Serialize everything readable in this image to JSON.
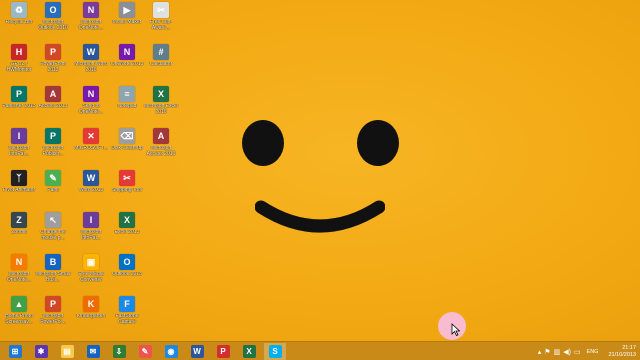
{
  "desktop": {
    "icons": [
      {
        "label": "Recycle Bin",
        "icon": "recycle-bin-icon",
        "color": "#9bb8c9",
        "glyph": "♻"
      },
      {
        "label": "Microsoft Outlook 2010",
        "icon": "outlook-icon",
        "color": "#2a6ebb",
        "glyph": "O"
      },
      {
        "label": "Microsoft OneNote...",
        "icon": "onenote-icon",
        "color": "#7b3b9a",
        "glyph": "N"
      },
      {
        "label": "Movie Maker",
        "icon": "movie-maker-icon",
        "color": "#8a8f9a",
        "glyph": "▶"
      },
      {
        "label": "Free Clip-Aware...",
        "icon": "clip-icon",
        "color": "#e0e0e0",
        "glyph": "✂"
      },
      {
        "label": "GPUZ / HWMonitor",
        "icon": "hwmonitor-icon",
        "color": "#c62828",
        "glyph": "H"
      },
      {
        "label": "PowerPoint 2013",
        "icon": "powerpoint-icon",
        "color": "#d24726",
        "glyph": "P"
      },
      {
        "label": "Microsoft Word 2010",
        "icon": "word-icon",
        "color": "#2b579a",
        "glyph": "W"
      },
      {
        "label": "OneNote 2013",
        "icon": "onenote-icon",
        "color": "#7719aa",
        "glyph": "N"
      },
      {
        "label": "Calculator",
        "icon": "calculator-icon",
        "color": "#607d8b",
        "glyph": "#"
      },
      {
        "label": "Publisher 2013",
        "icon": "publisher-icon",
        "color": "#077568",
        "glyph": "P"
      },
      {
        "label": "Access 2013",
        "icon": "access-icon",
        "color": "#a4373a",
        "glyph": "A"
      },
      {
        "label": "Send to OneNote...",
        "icon": "send-onenote-icon",
        "color": "#7719aa",
        "glyph": "N"
      },
      {
        "label": "Notepad",
        "icon": "notepad-icon",
        "color": "#90a4ae",
        "glyph": "≡"
      },
      {
        "label": "Microsoft Excel 2010",
        "icon": "excel-icon",
        "color": "#217346",
        "glyph": "X"
      },
      {
        "label": "Microsoft InfoPat...",
        "icon": "infopath-icon",
        "color": "#6a3d9a",
        "glyph": "I"
      },
      {
        "label": "Microsoft Publish...",
        "icon": "publisher-icon",
        "color": "#077568",
        "glyph": "P"
      },
      {
        "label": "MICROSOFT...",
        "icon": "media-icon",
        "color": "#e53935",
        "glyph": "✕"
      },
      {
        "label": "Disk Clean-up",
        "icon": "disk-cleanup-icon",
        "color": "#9e9e9e",
        "glyph": "⌫"
      },
      {
        "label": "Microsoft Access 2010",
        "icon": "access-icon",
        "color": "#a4373a",
        "glyph": "A"
      },
      {
        "label": "Pivot Animator",
        "icon": "pivot-icon",
        "color": "#212121",
        "glyph": "ᛉ"
      },
      {
        "label": "Paint",
        "icon": "paint-icon",
        "color": "#4caf50",
        "glyph": "✎"
      },
      {
        "label": "Word 2013",
        "icon": "word-icon",
        "color": "#2b579a",
        "glyph": "W"
      },
      {
        "label": "Snipping Tool",
        "icon": "snipping-tool-icon",
        "color": "#e53935",
        "glyph": "✂"
      },
      {
        "label": "Zoomit",
        "icon": "zoomit-icon",
        "color": "#37474f",
        "glyph": "Z"
      },
      {
        "label": "Change the mouse p...",
        "icon": "mouse-icon",
        "color": "#9e9e9e",
        "glyph": "↖"
      },
      {
        "label": "Microsoft InfoPat...",
        "icon": "infopath-icon",
        "color": "#6a3d9a",
        "glyph": "I"
      },
      {
        "label": "Excel 2013",
        "icon": "excel-icon",
        "color": "#217346",
        "glyph": "X"
      },
      {
        "label": "Microsoft OneNote...",
        "icon": "onenote-icon",
        "color": "#f57c00",
        "glyph": "N"
      },
      {
        "label": "Microsoft Small Busi...",
        "icon": "small-business-icon",
        "color": "#1565c0",
        "glyph": "B"
      },
      {
        "label": "Free Media Converter",
        "icon": "media-converter-icon",
        "color": "#ffb300",
        "glyph": "▣"
      },
      {
        "label": "Outlook 2013",
        "icon": "outlook-icon",
        "color": "#0072c6",
        "glyph": "O"
      },
      {
        "label": "Home Photo Screensav...",
        "icon": "photo-icon",
        "color": "#43a047",
        "glyph": "▲"
      },
      {
        "label": "Microsoft PowerPoi...",
        "icon": "powerpoint-icon",
        "color": "#d24726",
        "glyph": "P"
      },
      {
        "label": "Kindergarten",
        "icon": "kindergarten-icon",
        "color": "#ef6c00",
        "glyph": "K"
      },
      {
        "label": "FastStone Capture",
        "icon": "faststone-icon",
        "color": "#1e88e5",
        "glyph": "F"
      }
    ]
  },
  "taskbar": {
    "buttons": [
      {
        "name": "start-button",
        "icon": "windows-logo-icon",
        "color": "#1f78d1",
        "glyph": "⊞"
      },
      {
        "name": "taskbar-settings",
        "icon": "settings-icon",
        "color": "#5e35b1",
        "glyph": "✱"
      },
      {
        "name": "taskbar-explorer",
        "icon": "file-explorer-icon",
        "color": "#f9c846",
        "glyph": "▤"
      },
      {
        "name": "taskbar-outlook",
        "icon": "mail-icon",
        "color": "#1565c0",
        "glyph": "✉"
      },
      {
        "name": "taskbar-store",
        "icon": "download-icon",
        "color": "#2e7d32",
        "glyph": "⇩"
      },
      {
        "name": "taskbar-paint",
        "icon": "paint-icon",
        "color": "#ef5350",
        "glyph": "✎"
      },
      {
        "name": "taskbar-ie",
        "icon": "globe-icon",
        "color": "#1e88e5",
        "glyph": "◉"
      },
      {
        "name": "taskbar-word",
        "icon": "word-icon",
        "color": "#2b579a",
        "glyph": "W"
      },
      {
        "name": "taskbar-pdf",
        "icon": "pdf-icon",
        "color": "#d32f2f",
        "glyph": "P"
      },
      {
        "name": "taskbar-excel",
        "icon": "excel-icon",
        "color": "#217346",
        "glyph": "X"
      },
      {
        "name": "taskbar-skype",
        "icon": "skype-icon",
        "color": "#00aff0",
        "glyph": "S"
      }
    ],
    "tray": {
      "language": "ENG",
      "time": "21:17",
      "date": "21/10/2013"
    }
  }
}
